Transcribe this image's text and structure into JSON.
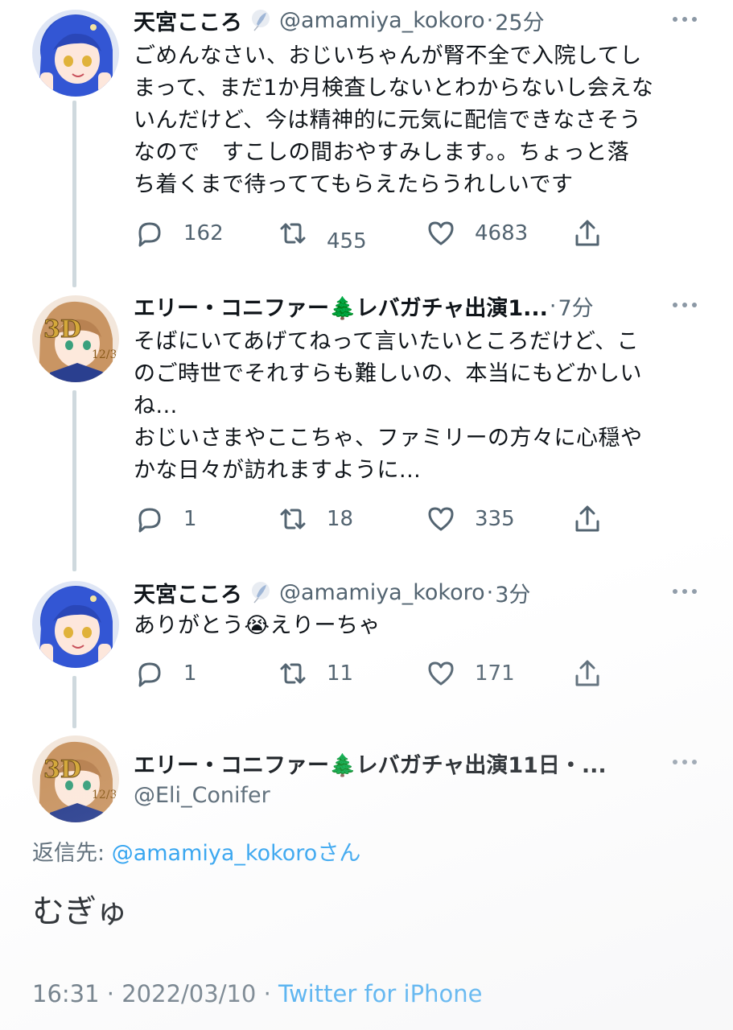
{
  "tweets": [
    {
      "name": "天宮こころ",
      "handle": "@amamiya_kokoro",
      "dot": "·",
      "time": "25分",
      "badge_icon": "feather-badge-icon",
      "text_lines": [
        "ごめんなさい、おじいちゃんが腎不全で入院してし",
        "まって、まだ1か月検査しないとわからないし会えな",
        "いんだけど、今は精神的に元気に配信できなさそう",
        "なので　すこしの間おやすみします。。ちょっと落",
        "ち着くまで待っててもらえたらうれしいです"
      ],
      "replies": "162",
      "retweets": "455",
      "likes": "4683"
    },
    {
      "name": "エリー・コニファー🌲レバガチャ出演1...",
      "handle": "",
      "dot": "·",
      "time": "7分",
      "text_lines": [
        "そばにいてあげてねって言いたいところだけど、こ",
        "のご時世でそれすらも難しいの、本当にもどかしい",
        "ね...",
        "おじいさまやここちゃ、ファミリーの方々に心穏や",
        "かな日々が訪れますように..."
      ],
      "replies": "1",
      "retweets": "18",
      "likes": "335"
    },
    {
      "name": "天宮こころ",
      "handle": "@amamiya_kokoro",
      "dot": "·",
      "time": "3分",
      "badge_icon": "feather-badge-icon",
      "text_lines": [
        "ありがとう😭えりーちゃ"
      ],
      "replies": "1",
      "retweets": "11",
      "likes": "171"
    }
  ],
  "main_tweet": {
    "name": "エリー・コニファー🌲レバガチャ出演11日・...",
    "handle": "@Eli_Conifer",
    "reply_prefix": "返信先: ",
    "reply_to": "@amamiya_kokoro",
    "reply_suffix": "さん",
    "text": "むぎゅ",
    "time": "16:31",
    "sep1": " · ",
    "date": "2022/03/10",
    "sep2": " · ",
    "source": "Twitter for iPhone"
  },
  "colors": {
    "text": "#0f1419",
    "secondary": "#536471",
    "link": "#1d9bf0",
    "thread_line": "#cfd9de"
  },
  "avatar_labels": {
    "eli_badge": "3D",
    "eli_date": "12/3"
  }
}
